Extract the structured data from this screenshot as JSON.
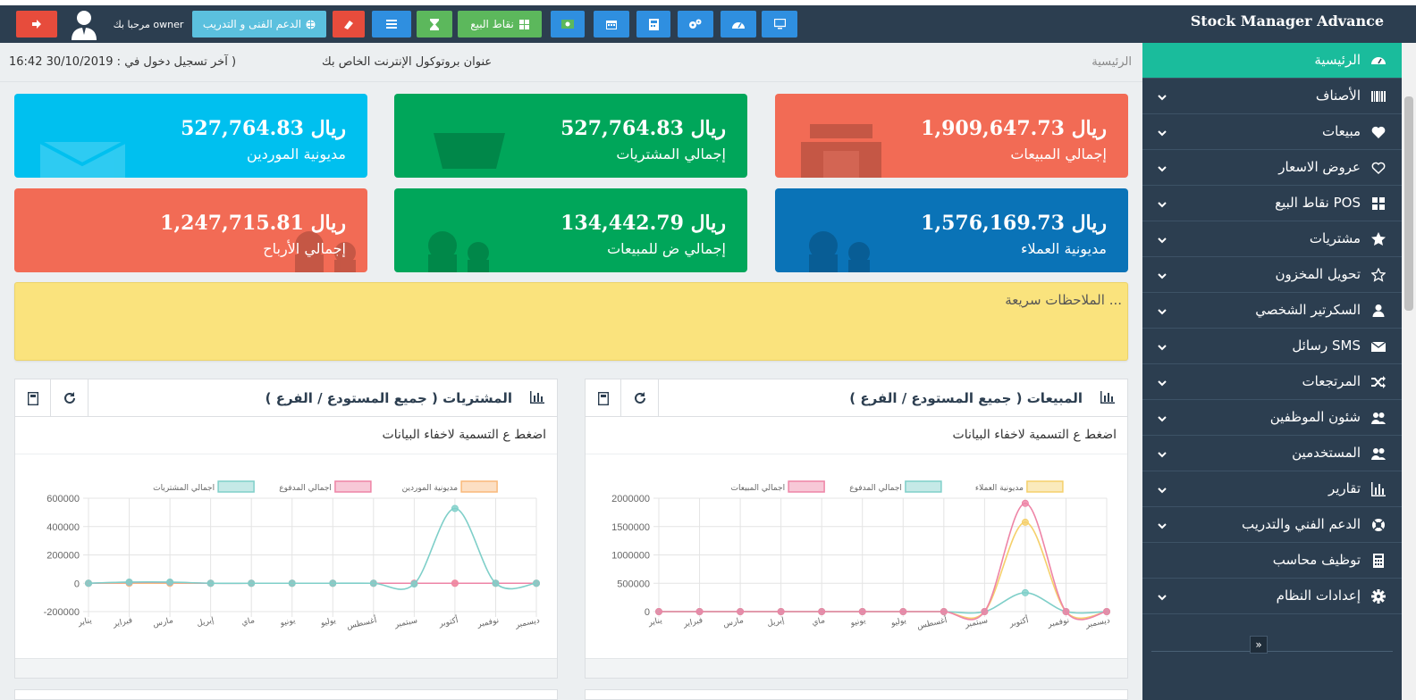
{
  "app": {
    "brand": "Stock Manager Advance"
  },
  "toolbar": {
    "welcome": "مرحبا بك owner",
    "support_label": "الدعم الفنى و التدريب",
    "pos_label": "نقاط البيع"
  },
  "colors": {
    "topbar": "#2c3e50",
    "sidebar": "#2c3e50",
    "sidebar_active": "#1abc9c",
    "blue_btn": "#2f8fe0",
    "red_btn": "#e74c3c",
    "green_btn": "#5cb85c",
    "teal_btn": "#5bc0de",
    "card_red": "#f26b55",
    "card_green": "#00a65a",
    "card_cyan": "#00c0ef",
    "card_blue": "#0a73b7",
    "notes": "#fae37d"
  },
  "sidebar": {
    "items": [
      {
        "label": "الرئيسية",
        "icon": "dashboard-icon",
        "active": true,
        "chevron": false
      },
      {
        "label": "الأصناف",
        "icon": "barcode-icon",
        "chevron": true
      },
      {
        "label": "مبيعات",
        "icon": "heart-icon",
        "chevron": true
      },
      {
        "label": "عروض الاسعار",
        "icon": "heart-outline-icon",
        "chevron": true
      },
      {
        "label": "نقاط البيع POS",
        "icon": "grid-icon",
        "chevron": true
      },
      {
        "label": "مشتريات",
        "icon": "star-icon",
        "chevron": true
      },
      {
        "label": "تحويل المخزون",
        "icon": "star-outline-icon",
        "chevron": true
      },
      {
        "label": "السكرتير الشخصي",
        "icon": "user-icon",
        "chevron": true
      },
      {
        "label": "رسائل SMS",
        "icon": "envelope-icon",
        "chevron": true
      },
      {
        "label": "المرتجعات",
        "icon": "random-icon",
        "chevron": true
      },
      {
        "label": "شئون الموظفين",
        "icon": "users-icon",
        "chevron": true
      },
      {
        "label": "المستخدمين",
        "icon": "users-icon",
        "chevron": true
      },
      {
        "label": "تقارير",
        "icon": "bar-chart-icon",
        "chevron": true
      },
      {
        "label": "الدعم الفني والتدريب",
        "icon": "lifebuoy-icon",
        "chevron": true
      },
      {
        "label": "توظيف محاسب",
        "icon": "calculator-icon",
        "chevron": false
      },
      {
        "label": "إعدادات النظام",
        "icon": "cog-icon",
        "chevron": true
      }
    ],
    "collapse_glyph": "»"
  },
  "infobar": {
    "breadcrumb": "الرئيسية",
    "ip_label": "عنوان بروتوكول الإنترنت الخاص بك",
    "last_login": "آخر تسجيل دخول في : 30/10/2019 16:42 )"
  },
  "cards": [
    {
      "amount": "1,909,647.73 ريال",
      "title": "إجمالي المبيعات"
    },
    {
      "amount": "527,764.83 ريال",
      "title": "إجمالي المشتريات"
    },
    {
      "amount": "527,764.83 ريال",
      "title": "مديونية الموردين"
    },
    {
      "amount": "1,576,169.73 ريال",
      "title": "مديونية العملاء"
    },
    {
      "amount": "134,442.79 ريال",
      "title": "إجمالي ض للمبيعات"
    },
    {
      "amount": "1,247,715.81 ريال",
      "title": "إجمالي الأرباح"
    }
  ],
  "notes": {
    "placeholder": "الملاحظات سريعة ..."
  },
  "panels": {
    "sales": {
      "title": "المبيعات ( جميع المستودع / الفرع )",
      "hint": "اضغط ع التسمية لاخفاء البيانات"
    },
    "purchases": {
      "title": "المشتريات ( جميع المستودع / الفرع )",
      "hint": "اضغط ع التسمية لاخفاء البيانات"
    }
  },
  "chart_data": [
    {
      "type": "line",
      "categories": [
        "يناير",
        "فبراير",
        "مارس",
        "إبريل",
        "ماي",
        "يونيو",
        "يوليو",
        "أغسطس",
        "سبتمبر",
        "أكتوبر",
        "نوفمبر",
        "ديسمبر"
      ],
      "yticks": [
        0,
        500000,
        1000000,
        1500000,
        2000000
      ],
      "ylim": [
        0,
        2000000
      ],
      "legend_position": "top",
      "series": [
        {
          "name": "مديونية العملاء",
          "color": "#f5d06b",
          "values": [
            0,
            0,
            0,
            0,
            0,
            0,
            0,
            0,
            0,
            1576170,
            0,
            0
          ]
        },
        {
          "name": "اجمالي المدفوع",
          "color": "#7fcfc9",
          "values": [
            0,
            0,
            0,
            0,
            0,
            0,
            0,
            0,
            0,
            333478,
            0,
            0
          ]
        },
        {
          "name": "اجمالي المبيعات",
          "color": "#ee84a6",
          "values": [
            0,
            0,
            0,
            0,
            0,
            0,
            0,
            0,
            0,
            1909648,
            0,
            0
          ]
        }
      ]
    },
    {
      "type": "line",
      "categories": [
        "يناير",
        "فبراير",
        "مارس",
        "إبريل",
        "ماي",
        "يونيو",
        "يوليو",
        "أغسطس",
        "سبتمبر",
        "أكتوبر",
        "نوفمبر",
        "ديسمبر"
      ],
      "yticks": [
        -200000,
        0,
        200000,
        400000,
        600000
      ],
      "ylim": [
        -200000,
        600000
      ],
      "legend_position": "top",
      "series": [
        {
          "name": "مديونية الموردين",
          "color": "#f9b97a",
          "values": [
            0,
            0,
            0,
            0,
            0,
            0,
            0,
            0,
            0,
            0,
            0,
            0
          ]
        },
        {
          "name": "اجمالي المدفوع",
          "color": "#ee84a6",
          "values": [
            0,
            6000,
            6000,
            0,
            0,
            0,
            0,
            0,
            0,
            0,
            0,
            0
          ]
        },
        {
          "name": "اجمالي المشتريات",
          "color": "#7fcfc9",
          "values": [
            0,
            8000,
            8000,
            0,
            0,
            0,
            0,
            0,
            -5000,
            527765,
            0,
            0
          ]
        }
      ]
    }
  ]
}
